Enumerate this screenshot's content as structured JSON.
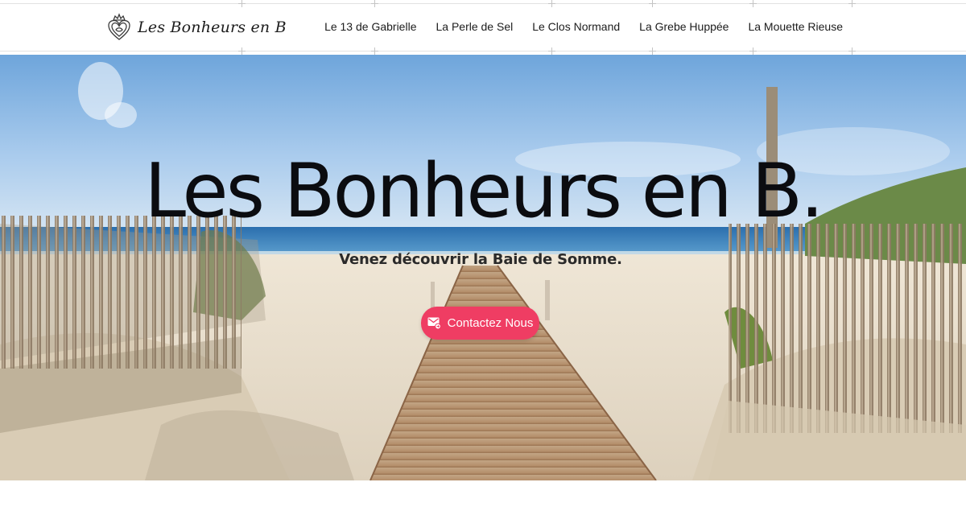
{
  "site": {
    "brand_name": "Les Bonheurs en B",
    "brand_icon": "heart-crown-logo-icon"
  },
  "nav": {
    "items": [
      {
        "label": "Le 13 de Gabrielle"
      },
      {
        "label": "La Perle de Sel"
      },
      {
        "label": "Le Clos Normand"
      },
      {
        "label": "La Grebe Huppée"
      },
      {
        "label": "La Mouette Rieuse"
      }
    ]
  },
  "hero": {
    "title": "Les Bonheurs en B.",
    "subtitle": "Venez découvrir la Baie de Somme.",
    "cta_label": "Contactez Nous",
    "cta_icon": "mail-icon",
    "background_image": "beach-boardwalk-photo"
  },
  "colors": {
    "accent": "#ef3d63",
    "text": "#1c1c1c",
    "title": "#0b0c10",
    "sky": "#7fb3e0",
    "sea": "#2f78b4",
    "sand": "#e9ddc9"
  }
}
